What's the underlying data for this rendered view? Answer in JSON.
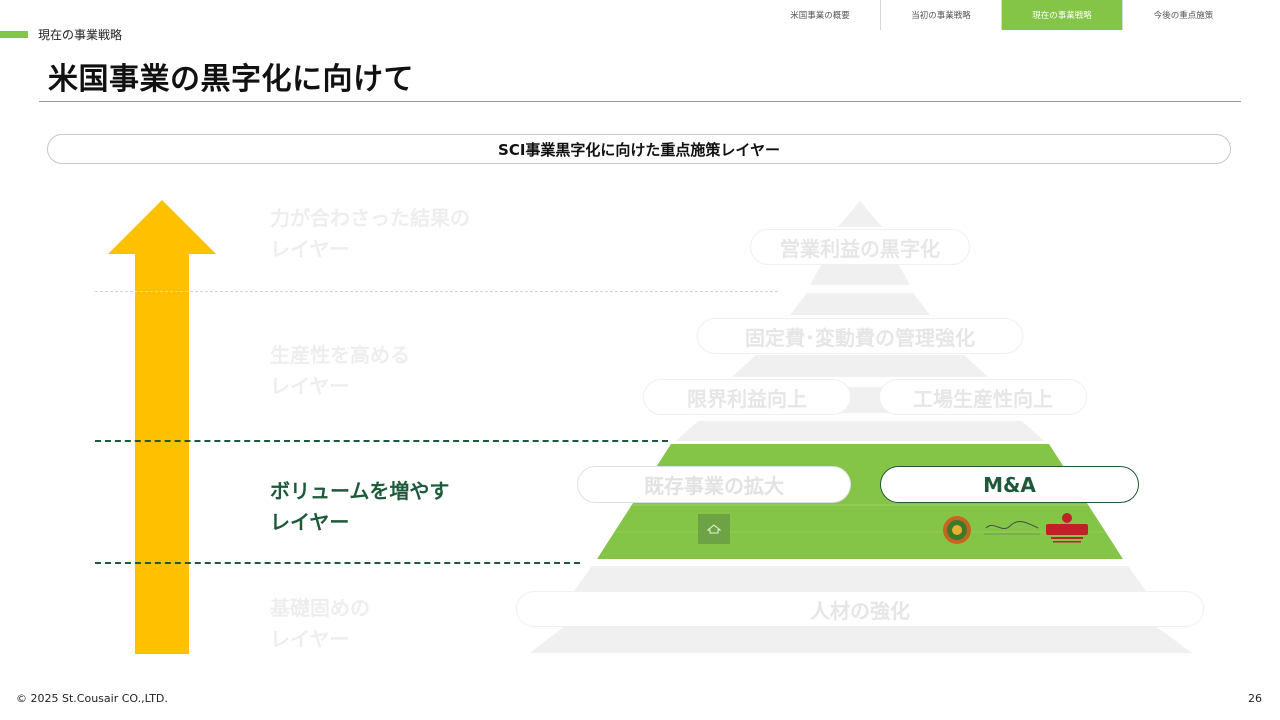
{
  "nav": {
    "tabs": [
      {
        "label": "米国事業の概要",
        "active": false
      },
      {
        "label": "当初の事業戦略",
        "active": false
      },
      {
        "label": "現在の事業戦略",
        "active": true
      },
      {
        "label": "今後の重点施策",
        "active": false
      }
    ]
  },
  "header": {
    "section_label": "現在の事業戦略",
    "title": "米国事業の黒字化に向けて"
  },
  "banner": "SCI事業黒字化に向けた重点施策レイヤー",
  "layers": [
    {
      "line1": "力が合わさった結果の",
      "line2": "レイヤー",
      "current": false
    },
    {
      "line1": "生産性を高める",
      "line2": "レイヤー",
      "current": false
    },
    {
      "line1": "ボリュームを増やす",
      "line2": "レイヤー",
      "current": true
    },
    {
      "line1": "基礎固めの",
      "line2": "レイヤー",
      "current": false
    }
  ],
  "pyramid": {
    "operating_profit": "営業利益の黒字化",
    "cost_control": "固定費･変動費の管理強化",
    "marginal_profit": "限界利益向上",
    "factory_productivity": "工場生産性向上",
    "existing_expansion": "既存事業の拡大",
    "ma": "M&A",
    "talent": "人材の強化"
  },
  "colors": {
    "accent_green": "#84c446",
    "dark_green": "#1d5a3a",
    "arrow_yellow": "#ffc000"
  },
  "footer": {
    "copyright": "© 2025 St.Cousair CO.,LTD.",
    "page_number": "26"
  }
}
